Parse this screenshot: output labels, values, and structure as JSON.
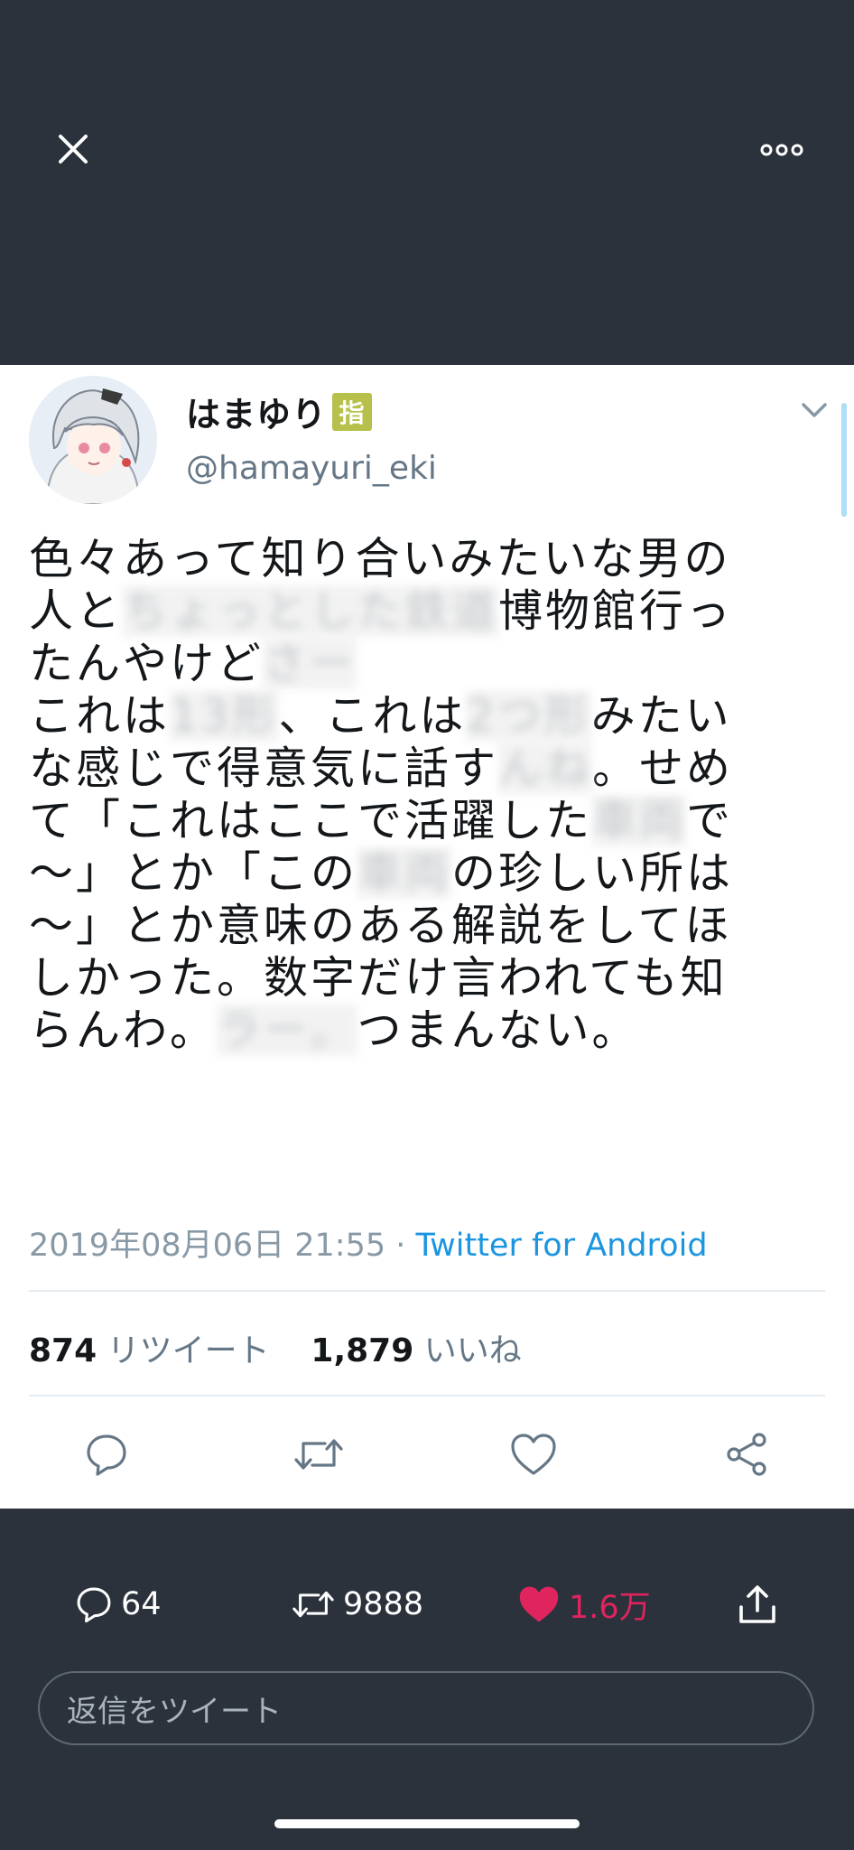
{
  "header": {
    "close_icon": "close-icon",
    "more_icon": "more-dots-icon"
  },
  "tweet": {
    "display_name": "はまゆり",
    "badge_text": "指",
    "handle": "@hamayuri_eki",
    "text_lines": [
      {
        "segments": [
          {
            "t": "色々あって知り合いみたいな男の"
          }
        ]
      },
      {
        "segments": [
          {
            "t": "人と"
          },
          {
            "t": "ちょっとした鉄道",
            "r": true
          },
          {
            "t": "博物館行っ"
          }
        ]
      },
      {
        "segments": [
          {
            "t": "たんやけど"
          },
          {
            "t": "さー",
            "r": true
          }
        ]
      },
      {
        "segments": [
          {
            "t": "これは"
          },
          {
            "t": "13形",
            "r": true
          },
          {
            "t": "、これは"
          },
          {
            "t": "2つ形",
            "r": true
          },
          {
            "t": "みたい"
          }
        ]
      },
      {
        "segments": [
          {
            "t": "な感じで得意気に話す"
          },
          {
            "t": "んね",
            "r": true
          },
          {
            "t": "。せめ"
          }
        ]
      },
      {
        "segments": [
          {
            "t": "て「これはここで活躍した"
          },
          {
            "t": "車両",
            "r": true
          },
          {
            "t": "で"
          }
        ]
      },
      {
        "segments": [
          {
            "t": "〜」とか「この"
          },
          {
            "t": "車両",
            "r": true
          },
          {
            "t": "の珍しい所は"
          }
        ]
      },
      {
        "segments": [
          {
            "t": "〜」とか意味のある解説をしてほ"
          }
        ]
      },
      {
        "segments": [
          {
            "t": "しかった。数字だけ言われても知"
          }
        ]
      },
      {
        "segments": [
          {
            "t": "らんわ。"
          },
          {
            "t": "ラー。",
            "r": true
          },
          {
            "t": "つまんない。"
          }
        ]
      }
    ],
    "timestamp": "2019年08月06日 21:55",
    "separator": " · ",
    "source": "Twitter for Android",
    "retweet_count": "874",
    "retweet_label": "リツイート",
    "like_count": "1,879",
    "like_label": "いいね"
  },
  "bottom_bar": {
    "replies": "64",
    "retweets": "9888",
    "likes": "1.6万",
    "reply_placeholder": "返信をツイート"
  },
  "colors": {
    "dark_bg": "#2b323c",
    "link_blue": "#1b95e0",
    "like_pink": "#e0245e",
    "icon_gray": "#657786"
  }
}
